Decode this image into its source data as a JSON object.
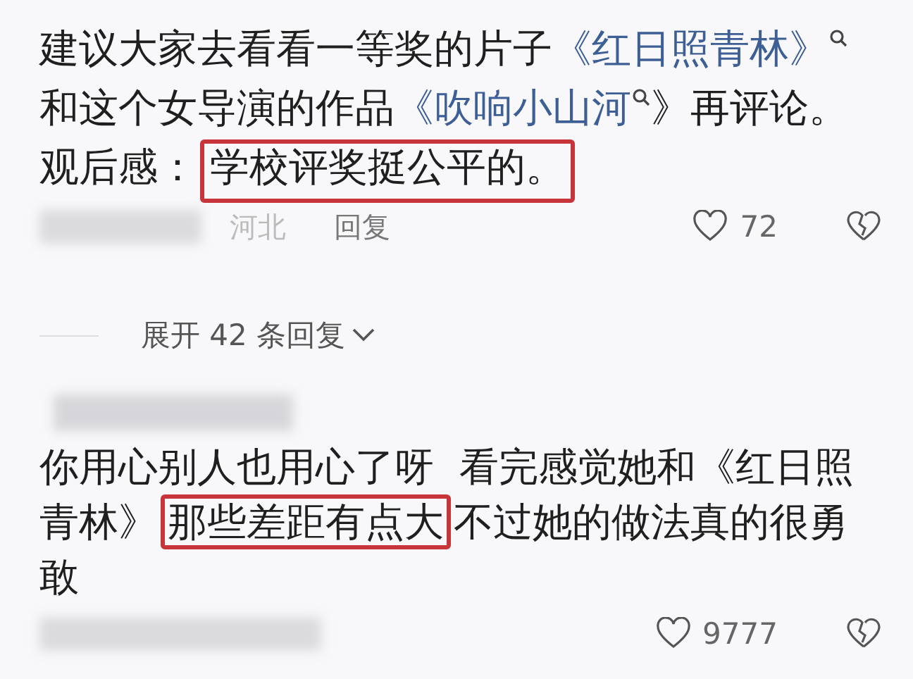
{
  "comments": [
    {
      "segments": [
        {
          "kind": "text",
          "text": "建议大家去看看一等奖的片子"
        },
        {
          "kind": "link",
          "text": "《红日照青林》"
        },
        {
          "kind": "search"
        },
        {
          "kind": "text",
          "text": "和这个女导演的作品"
        },
        {
          "kind": "link",
          "text": "《吹响小山河"
        },
        {
          "kind": "search"
        },
        {
          "kind": "text",
          "text": "》再评论。观后感："
        },
        {
          "kind": "highlight",
          "text": "学校评奖挺公平的。"
        }
      ],
      "location": "河北",
      "reply": "回复",
      "likes": "72"
    },
    {
      "segments": [
        {
          "kind": "text",
          "text": "你用心别人也用心了呀  看完感觉她和《红日照青林》"
        },
        {
          "kind": "highlight",
          "text": "那些差距有点大"
        },
        {
          "kind": "text",
          "text": "不过她的做法真的很勇敢"
        }
      ],
      "likes": "9777"
    }
  ],
  "expand": {
    "label": "展开 42 条回复"
  }
}
